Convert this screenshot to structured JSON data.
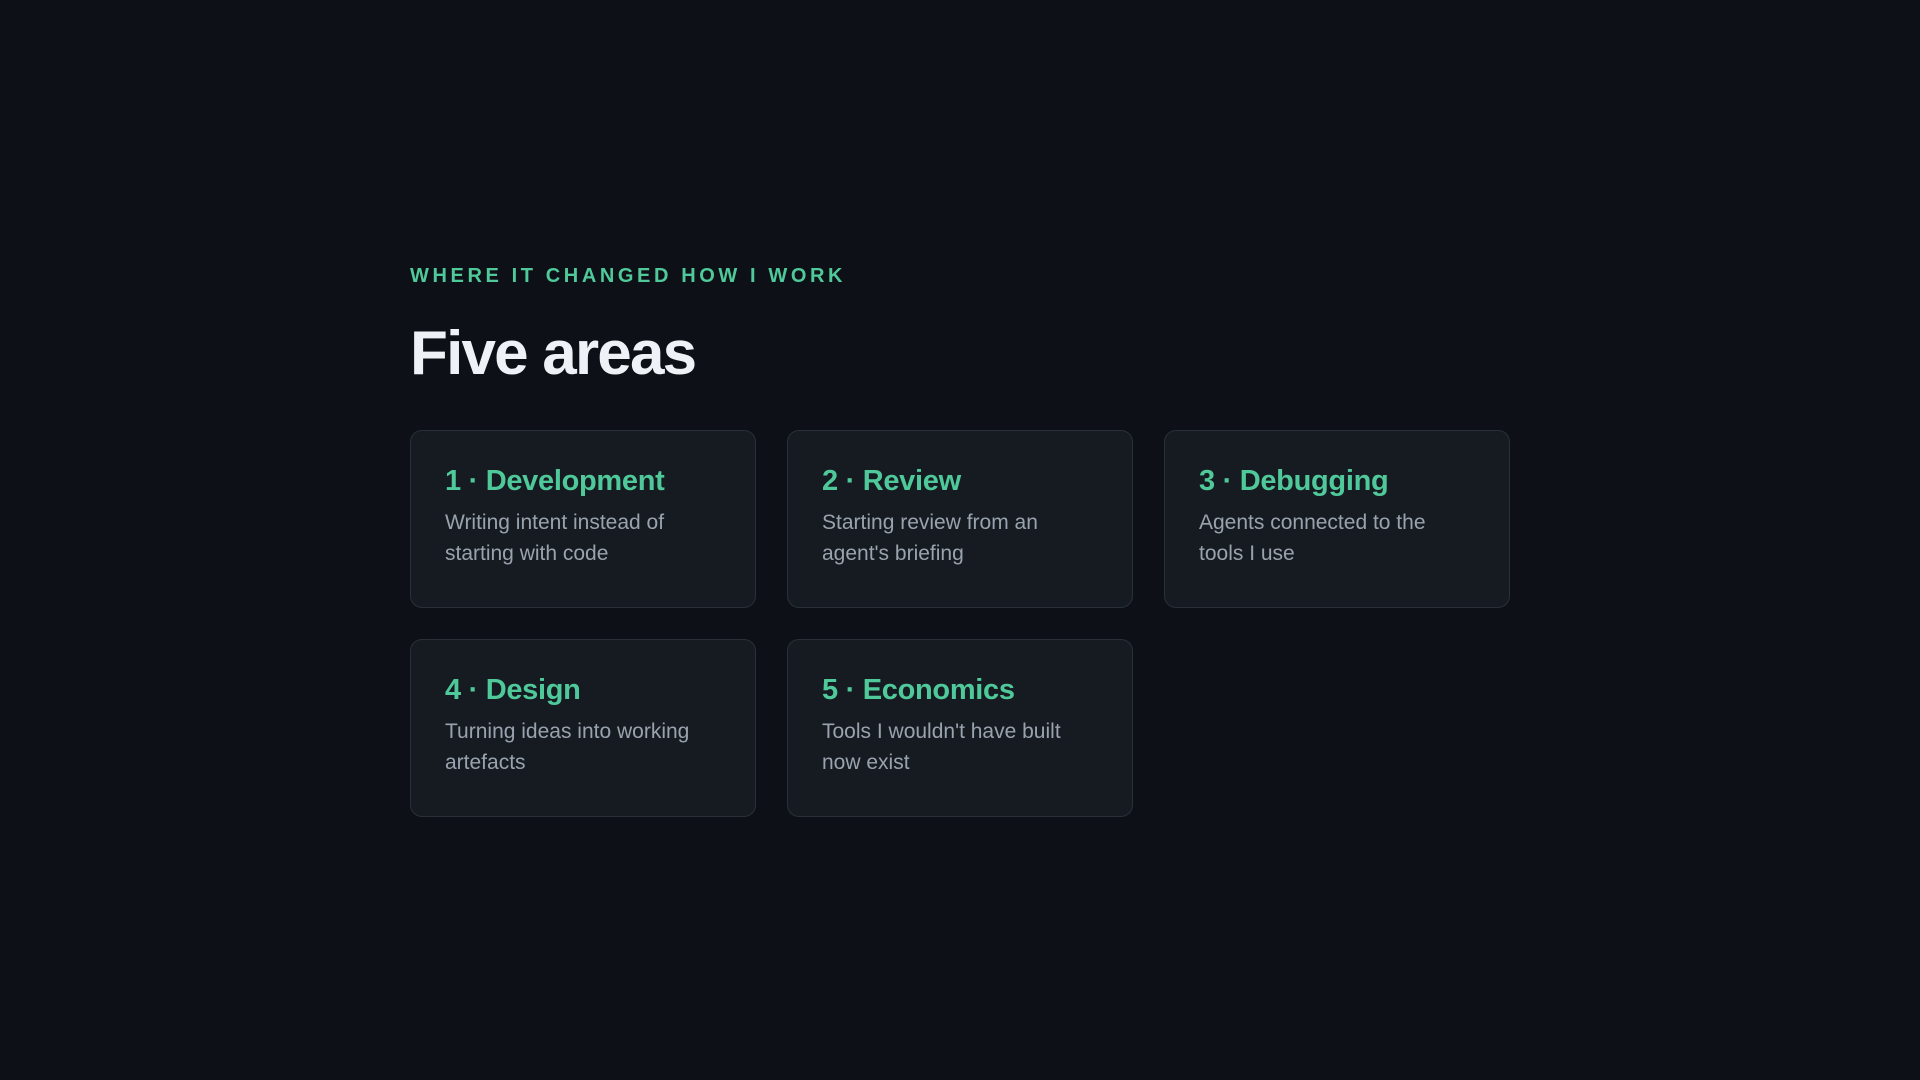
{
  "slide": {
    "eyebrow": "WHERE IT CHANGED HOW I WORK",
    "title": "Five areas",
    "cards": [
      {
        "title": "1 · Development",
        "description": "Writing intent instead of starting with code"
      },
      {
        "title": "2 · Review",
        "description": "Starting review from an agent's briefing"
      },
      {
        "title": "3 · Debugging",
        "description": "Agents connected to the tools I use"
      },
      {
        "title": "4 · Design",
        "description": "Turning ideas into working artefacts"
      },
      {
        "title": "5 · Economics",
        "description": "Tools I wouldn't have built now exist"
      }
    ]
  },
  "colors": {
    "background": "#0d1117",
    "card_background": "#161b22",
    "card_border": "#2a3038",
    "accent": "#4fc99a",
    "title_text": "#eef1f5",
    "body_text": "#9aa3ad"
  }
}
